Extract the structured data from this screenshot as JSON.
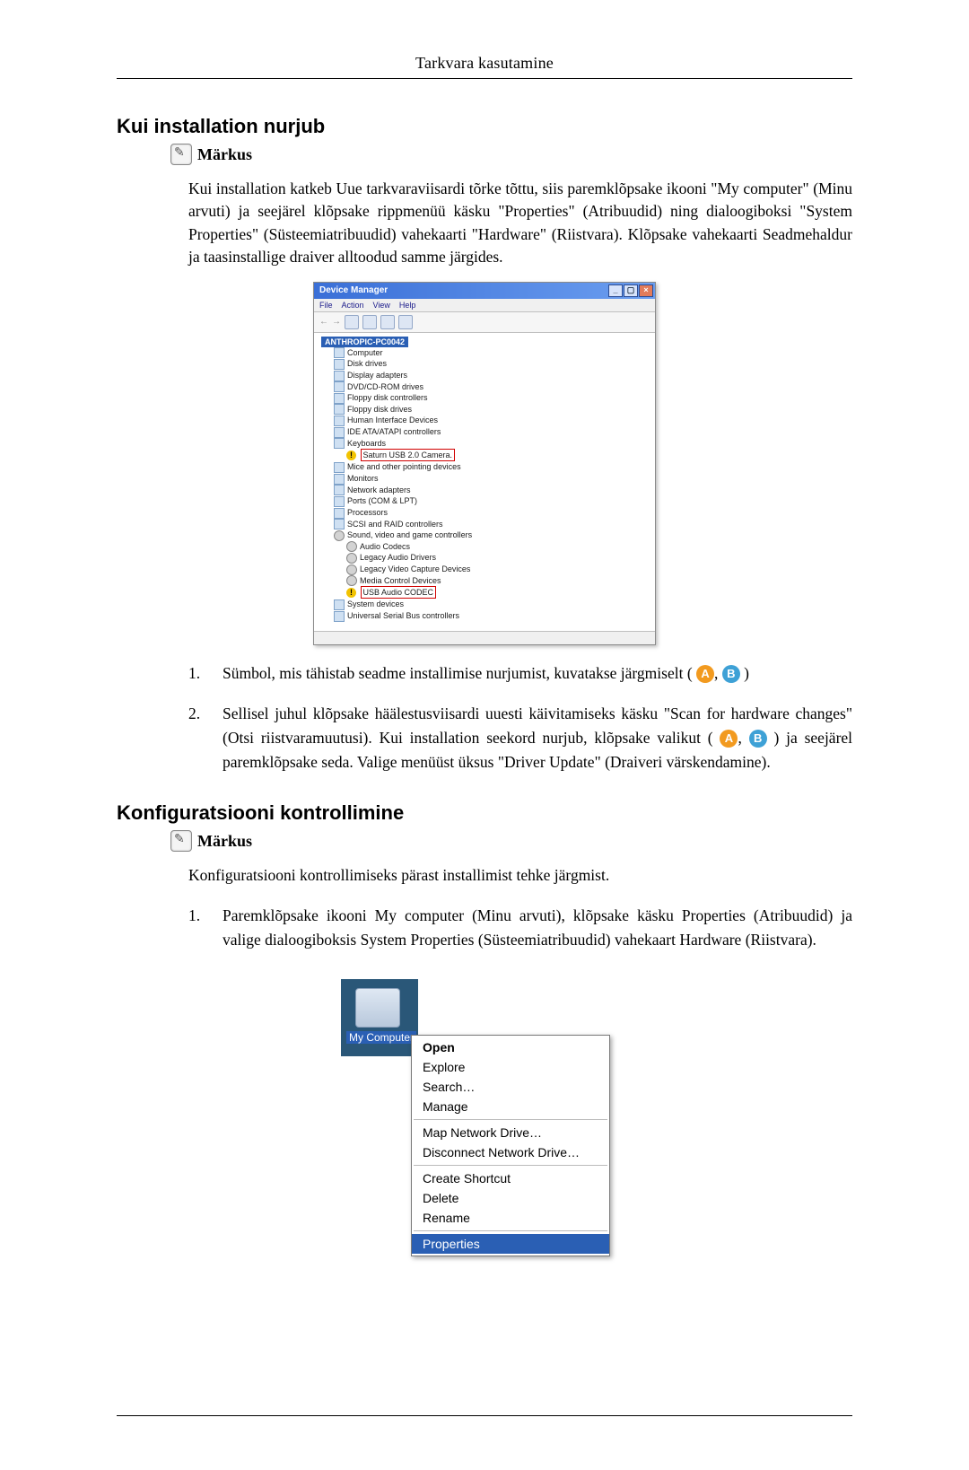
{
  "header": "Tarkvara kasutamine",
  "section1": {
    "title": "Kui installation nurjub",
    "note_label": "Märkus",
    "para": "Kui installation katkeb Uue tarkvaraviisardi tõrke tõttu, siis paremklõpsake ikooni \"My computer\" (Minu arvuti) ja seejärel klõpsake rippmenüü käsku \"Properties\" (Atribuudid) ning dialoogiboksi \"System Properties\" (Süsteemiatribuudid) vahekaarti \"Hardware\" (Riistvara). Klõpsake vahekaarti Seadmehaldur ja taasinstallige draiver alltoodud samme järgides.",
    "list": {
      "item1": "Sümbol, mis tähistab seadme installimise nurjumist, kuvatakse järgmiselt (",
      "item1_end": ")",
      "item2a": "Sellisel juhul klõpsake häälestusviisardi uuesti käivitamiseks käsku \"Scan for hardware changes\" (Otsi riistvaramuutusi). Kui installation seekord nurjub, klõpsake valikut (",
      "item2b": ") ja seejärel paremklõpsake seda. Valige menüüst üksus \"Driver Update\" (Draiveri värskendamine)."
    }
  },
  "device_manager": {
    "title": "Device Manager",
    "menu": [
      "File",
      "Action",
      "View",
      "Help"
    ],
    "root": "ANTHROPIC-PC0042",
    "nodes": [
      "Computer",
      "Disk drives",
      "Display adapters",
      "DVD/CD-ROM drives",
      "Floppy disk controllers",
      "Floppy disk drives",
      "Human Interface Devices",
      "IDE ATA/ATAPI controllers",
      "Keyboards"
    ],
    "warn_a": "Saturn USB 2.0 Camera.",
    "nodes2": [
      "Mice and other pointing devices",
      "Monitors",
      "Network adapters",
      "Ports (COM & LPT)",
      "Processors",
      "SCSI and RAID controllers",
      "Sound, video and game controllers"
    ],
    "sound_children": [
      "Audio Codecs",
      "Legacy Audio Drivers",
      "Legacy Video Capture Devices",
      "Media Control Devices"
    ],
    "warn_b": "USB Audio CODEC",
    "nodes3": [
      "System devices",
      "Universal Serial Bus controllers"
    ]
  },
  "section2": {
    "title": "Konfiguratsiooni kontrollimine",
    "note_label": "Märkus",
    "para": "Konfiguratsiooni kontrollimiseks pärast installimist tehke järgmist.",
    "list": {
      "item1": "Paremklõpsake ikooni My computer (Minu arvuti), klõpsake käsku Properties (Atribuudid) ja valige dialoogiboksis System Properties (Süsteemiatribuudid) vahekaart Hardware (Riistvara)."
    }
  },
  "context_menu": {
    "icon_label": "My Computer",
    "items_top": [
      "Open",
      "Explore",
      "Search…",
      "Manage"
    ],
    "items_mid": [
      "Map Network Drive…",
      "Disconnect Network Drive…"
    ],
    "items_low": [
      "Create Shortcut",
      "Delete",
      "Rename"
    ],
    "selected": "Properties"
  },
  "badges": {
    "a": "A",
    "b": "B"
  }
}
